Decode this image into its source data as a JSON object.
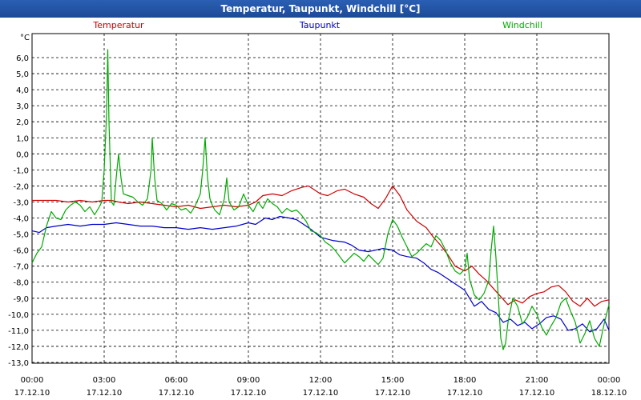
{
  "window": {
    "title": "Temperatur, Taupunkt, Windchill [°C]"
  },
  "chart_data": {
    "type": "line",
    "title": "Temperatur, Taupunkt, Windchill [°C]",
    "ylabel": "°C",
    "ylim": [
      -13,
      7
    ],
    "xlim": [
      0,
      24
    ],
    "yticks": [
      "6,0",
      "5,0",
      "4,0",
      "3,0",
      "2,0",
      "1,0",
      "0,0",
      "-1,0",
      "-2,0",
      "-3,0",
      "-4,0",
      "-5,0",
      "-6,0",
      "-7,0",
      "-8,0",
      "-9,0",
      "-10,0",
      "-11,0",
      "-12,0",
      "-13,0"
    ],
    "ytick_values": [
      6,
      5,
      4,
      3,
      2,
      1,
      0,
      -1,
      -2,
      -3,
      -4,
      -5,
      -6,
      -7,
      -8,
      -9,
      -10,
      -11,
      -12,
      -13
    ],
    "xticks": [
      {
        "time": "00:00",
        "date": "17.12.10",
        "hour": 0
      },
      {
        "time": "03:00",
        "date": "17.12.10",
        "hour": 3
      },
      {
        "time": "06:00",
        "date": "17.12.10",
        "hour": 6
      },
      {
        "time": "09:00",
        "date": "17.12.10",
        "hour": 9
      },
      {
        "time": "12:00",
        "date": "17.12.10",
        "hour": 12
      },
      {
        "time": "15:00",
        "date": "17.12.10",
        "hour": 15
      },
      {
        "time": "18:00",
        "date": "17.12.10",
        "hour": 18
      },
      {
        "time": "21:00",
        "date": "17.12.10",
        "hour": 21
      },
      {
        "time": "00:00",
        "date": "18.12.10",
        "hour": 24
      }
    ],
    "grid": true,
    "legend_placement": "top",
    "series": [
      {
        "name": "Temperatur",
        "color": "#cc0000",
        "points": [
          [
            0,
            -2.9
          ],
          [
            0.5,
            -2.9
          ],
          [
            1,
            -2.9
          ],
          [
            1.5,
            -3.0
          ],
          [
            2,
            -2.9
          ],
          [
            2.5,
            -3.0
          ],
          [
            3,
            -2.9
          ],
          [
            3.3,
            -2.9
          ],
          [
            3.6,
            -3.0
          ],
          [
            4,
            -3.1
          ],
          [
            4.5,
            -3.0
          ],
          [
            5,
            -3.1
          ],
          [
            5.5,
            -3.2
          ],
          [
            6,
            -3.3
          ],
          [
            6.5,
            -3.2
          ],
          [
            7,
            -3.4
          ],
          [
            7.5,
            -3.3
          ],
          [
            8,
            -3.2
          ],
          [
            8.5,
            -3.3
          ],
          [
            9,
            -3.2
          ],
          [
            9.3,
            -3.0
          ],
          [
            9.6,
            -2.6
          ],
          [
            10,
            -2.5
          ],
          [
            10.4,
            -2.6
          ],
          [
            10.8,
            -2.3
          ],
          [
            11.2,
            -2.1
          ],
          [
            11.5,
            -2.0
          ],
          [
            11.8,
            -2.3
          ],
          [
            12,
            -2.5
          ],
          [
            12.3,
            -2.6
          ],
          [
            12.7,
            -2.3
          ],
          [
            13,
            -2.2
          ],
          [
            13.4,
            -2.5
          ],
          [
            13.8,
            -2.7
          ],
          [
            14.1,
            -3.1
          ],
          [
            14.4,
            -3.4
          ],
          [
            14.7,
            -2.8
          ],
          [
            15,
            -2.0
          ],
          [
            15.3,
            -2.6
          ],
          [
            15.6,
            -3.5
          ],
          [
            16,
            -4.2
          ],
          [
            16.4,
            -4.6
          ],
          [
            16.7,
            -5.2
          ],
          [
            17,
            -5.7
          ],
          [
            17.3,
            -6.3
          ],
          [
            17.6,
            -7.0
          ],
          [
            18,
            -7.3
          ],
          [
            18.3,
            -7.0
          ],
          [
            18.6,
            -7.5
          ],
          [
            18.9,
            -7.9
          ],
          [
            19.2,
            -8.4
          ],
          [
            19.5,
            -8.9
          ],
          [
            19.8,
            -9.4
          ],
          [
            20.1,
            -9.1
          ],
          [
            20.4,
            -9.3
          ],
          [
            20.7,
            -8.9
          ],
          [
            21,
            -8.7
          ],
          [
            21.3,
            -8.6
          ],
          [
            21.6,
            -8.3
          ],
          [
            21.9,
            -8.2
          ],
          [
            22.2,
            -8.6
          ],
          [
            22.5,
            -9.2
          ],
          [
            22.8,
            -9.5
          ],
          [
            23.1,
            -9.0
          ],
          [
            23.4,
            -9.5
          ],
          [
            23.7,
            -9.2
          ],
          [
            24,
            -9.1
          ]
        ]
      },
      {
        "name": "Taupunkt",
        "color": "#0000cc",
        "points": [
          [
            0,
            -4.8
          ],
          [
            0.3,
            -4.9
          ],
          [
            0.6,
            -4.6
          ],
          [
            1,
            -4.5
          ],
          [
            1.5,
            -4.4
          ],
          [
            2,
            -4.5
          ],
          [
            2.5,
            -4.4
          ],
          [
            3,
            -4.4
          ],
          [
            3.5,
            -4.3
          ],
          [
            4,
            -4.4
          ],
          [
            4.5,
            -4.5
          ],
          [
            5,
            -4.5
          ],
          [
            5.5,
            -4.6
          ],
          [
            6,
            -4.6
          ],
          [
            6.5,
            -4.7
          ],
          [
            7,
            -4.6
          ],
          [
            7.5,
            -4.7
          ],
          [
            8,
            -4.6
          ],
          [
            8.5,
            -4.5
          ],
          [
            9,
            -4.3
          ],
          [
            9.3,
            -4.4
          ],
          [
            9.7,
            -4.0
          ],
          [
            10,
            -4.1
          ],
          [
            10.3,
            -3.9
          ],
          [
            10.7,
            -4.0
          ],
          [
            11,
            -4.1
          ],
          [
            11.3,
            -4.4
          ],
          [
            11.6,
            -4.7
          ],
          [
            12,
            -5.2
          ],
          [
            12.5,
            -5.4
          ],
          [
            13,
            -5.5
          ],
          [
            13.3,
            -5.7
          ],
          [
            13.6,
            -6.0
          ],
          [
            14,
            -6.1
          ],
          [
            14.3,
            -6.0
          ],
          [
            14.6,
            -5.9
          ],
          [
            15,
            -6.0
          ],
          [
            15.3,
            -6.3
          ],
          [
            15.6,
            -6.4
          ],
          [
            16,
            -6.5
          ],
          [
            16.3,
            -6.8
          ],
          [
            16.6,
            -7.2
          ],
          [
            16.9,
            -7.4
          ],
          [
            17.2,
            -7.7
          ],
          [
            17.5,
            -8.0
          ],
          [
            17.8,
            -8.3
          ],
          [
            18,
            -8.5
          ],
          [
            18.2,
            -9.0
          ],
          [
            18.4,
            -9.5
          ],
          [
            18.7,
            -9.2
          ],
          [
            19,
            -9.7
          ],
          [
            19.3,
            -9.9
          ],
          [
            19.6,
            -10.5
          ],
          [
            19.9,
            -10.3
          ],
          [
            20.2,
            -10.7
          ],
          [
            20.5,
            -10.5
          ],
          [
            20.8,
            -10.9
          ],
          [
            21.1,
            -10.6
          ],
          [
            21.4,
            -10.2
          ],
          [
            21.7,
            -10.1
          ],
          [
            22,
            -10.3
          ],
          [
            22.3,
            -11.0
          ],
          [
            22.6,
            -10.9
          ],
          [
            22.9,
            -10.6
          ],
          [
            23.2,
            -11.1
          ],
          [
            23.5,
            -10.9
          ],
          [
            23.8,
            -10.3
          ],
          [
            24,
            -11.0
          ]
        ]
      },
      {
        "name": "Windchill",
        "color": "#00aa00",
        "points": [
          [
            0,
            -6.8
          ],
          [
            0.2,
            -6.2
          ],
          [
            0.4,
            -5.8
          ],
          [
            0.6,
            -4.5
          ],
          [
            0.8,
            -3.6
          ],
          [
            1,
            -4.0
          ],
          [
            1.2,
            -4.1
          ],
          [
            1.4,
            -3.5
          ],
          [
            1.6,
            -3.2
          ],
          [
            1.8,
            -3.0
          ],
          [
            2,
            -3.2
          ],
          [
            2.2,
            -3.6
          ],
          [
            2.4,
            -3.3
          ],
          [
            2.6,
            -3.8
          ],
          [
            2.8,
            -3.3
          ],
          [
            2.9,
            -3.0
          ],
          [
            3,
            -1.0
          ],
          [
            3.1,
            2.5
          ],
          [
            3.15,
            6.5
          ],
          [
            3.2,
            2.0
          ],
          [
            3.3,
            -3.0
          ],
          [
            3.4,
            -3.2
          ],
          [
            3.5,
            -1.5
          ],
          [
            3.6,
            0.0
          ],
          [
            3.7,
            -1.5
          ],
          [
            3.8,
            -2.5
          ],
          [
            4,
            -2.6
          ],
          [
            4.2,
            -2.7
          ],
          [
            4.4,
            -3.0
          ],
          [
            4.6,
            -3.2
          ],
          [
            4.8,
            -2.8
          ],
          [
            4.95,
            -1.0
          ],
          [
            5.0,
            1.0
          ],
          [
            5.1,
            -1.5
          ],
          [
            5.2,
            -2.9
          ],
          [
            5.4,
            -3.1
          ],
          [
            5.6,
            -3.5
          ],
          [
            5.8,
            -3.1
          ],
          [
            6,
            -3.2
          ],
          [
            6.2,
            -3.5
          ],
          [
            6.4,
            -3.4
          ],
          [
            6.6,
            -3.7
          ],
          [
            6.8,
            -3.2
          ],
          [
            7.0,
            -2.5
          ],
          [
            7.1,
            -1.0
          ],
          [
            7.2,
            1.0
          ],
          [
            7.3,
            -1.5
          ],
          [
            7.4,
            -2.8
          ],
          [
            7.5,
            -3.2
          ],
          [
            7.6,
            -3.5
          ],
          [
            7.8,
            -3.8
          ],
          [
            8.0,
            -2.8
          ],
          [
            8.1,
            -1.5
          ],
          [
            8.2,
            -3.0
          ],
          [
            8.4,
            -3.5
          ],
          [
            8.6,
            -3.3
          ],
          [
            8.8,
            -2.5
          ],
          [
            9,
            -3.2
          ],
          [
            9.2,
            -3.6
          ],
          [
            9.4,
            -3.0
          ],
          [
            9.6,
            -3.4
          ],
          [
            9.8,
            -2.8
          ],
          [
            10,
            -3.1
          ],
          [
            10.2,
            -3.3
          ],
          [
            10.4,
            -3.7
          ],
          [
            10.6,
            -3.4
          ],
          [
            10.8,
            -3.6
          ],
          [
            11,
            -3.5
          ],
          [
            11.2,
            -3.8
          ],
          [
            11.4,
            -4.2
          ],
          [
            11.6,
            -4.8
          ],
          [
            11.8,
            -4.9
          ],
          [
            12,
            -5.1
          ],
          [
            12.2,
            -5.5
          ],
          [
            12.4,
            -5.7
          ],
          [
            12.6,
            -6.0
          ],
          [
            12.8,
            -6.4
          ],
          [
            13,
            -6.8
          ],
          [
            13.2,
            -6.5
          ],
          [
            13.4,
            -6.2
          ],
          [
            13.6,
            -6.4
          ],
          [
            13.8,
            -6.7
          ],
          [
            14,
            -6.3
          ],
          [
            14.2,
            -6.6
          ],
          [
            14.4,
            -6.9
          ],
          [
            14.6,
            -6.5
          ],
          [
            14.8,
            -5.0
          ],
          [
            15,
            -4.1
          ],
          [
            15.2,
            -4.5
          ],
          [
            15.4,
            -5.2
          ],
          [
            15.6,
            -5.8
          ],
          [
            15.8,
            -6.4
          ],
          [
            16,
            -6.2
          ],
          [
            16.2,
            -5.9
          ],
          [
            16.4,
            -5.6
          ],
          [
            16.6,
            -5.8
          ],
          [
            16.8,
            -5.1
          ],
          [
            17,
            -5.4
          ],
          [
            17.2,
            -6.0
          ],
          [
            17.4,
            -6.8
          ],
          [
            17.6,
            -7.3
          ],
          [
            17.8,
            -7.5
          ],
          [
            18,
            -7.2
          ],
          [
            18.1,
            -6.2
          ],
          [
            18.2,
            -7.8
          ],
          [
            18.4,
            -8.8
          ],
          [
            18.6,
            -9.1
          ],
          [
            18.8,
            -8.7
          ],
          [
            19,
            -7.9
          ],
          [
            19.1,
            -6.0
          ],
          [
            19.2,
            -4.5
          ],
          [
            19.3,
            -6.5
          ],
          [
            19.4,
            -9.0
          ],
          [
            19.5,
            -11.5
          ],
          [
            19.6,
            -12.2
          ],
          [
            19.7,
            -11.8
          ],
          [
            19.8,
            -10.5
          ],
          [
            20,
            -9.0
          ],
          [
            20.2,
            -9.5
          ],
          [
            20.4,
            -10.6
          ],
          [
            20.6,
            -10.2
          ],
          [
            20.8,
            -9.5
          ],
          [
            21,
            -10.0
          ],
          [
            21.2,
            -10.8
          ],
          [
            21.4,
            -11.3
          ],
          [
            21.6,
            -10.7
          ],
          [
            21.8,
            -10.2
          ],
          [
            22,
            -9.3
          ],
          [
            22.2,
            -9.0
          ],
          [
            22.4,
            -9.8
          ],
          [
            22.6,
            -10.5
          ],
          [
            22.8,
            -11.8
          ],
          [
            23,
            -11.2
          ],
          [
            23.2,
            -10.4
          ],
          [
            23.4,
            -11.5
          ],
          [
            23.6,
            -12.0
          ],
          [
            23.8,
            -10.6
          ],
          [
            24,
            -9.4
          ]
        ]
      }
    ]
  }
}
